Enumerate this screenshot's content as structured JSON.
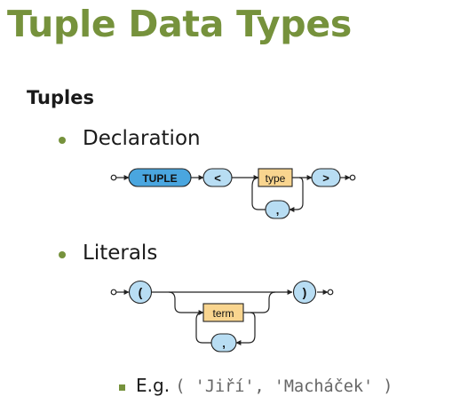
{
  "slide": {
    "title": "Tuple Data Types",
    "section": "Tuples",
    "bullets": [
      {
        "label": "Declaration"
      },
      {
        "label": "Literals"
      }
    ],
    "example": {
      "prefix": "E.g.",
      "code": "( 'Jiří', 'Macháček' )"
    }
  },
  "declaration_diagram": {
    "keyword": "TUPLE",
    "open": "<",
    "type": "type",
    "comma": ",",
    "close": ">"
  },
  "literal_diagram": {
    "open": "(",
    "term": "term",
    "comma": ",",
    "close": ")"
  },
  "colors": {
    "title": "#76923c",
    "bullet": "#76923c",
    "keyword_fill": "#4aa6df",
    "token_fill": "#b8ddf3",
    "nonterminal_fill": "#f9d58f"
  }
}
